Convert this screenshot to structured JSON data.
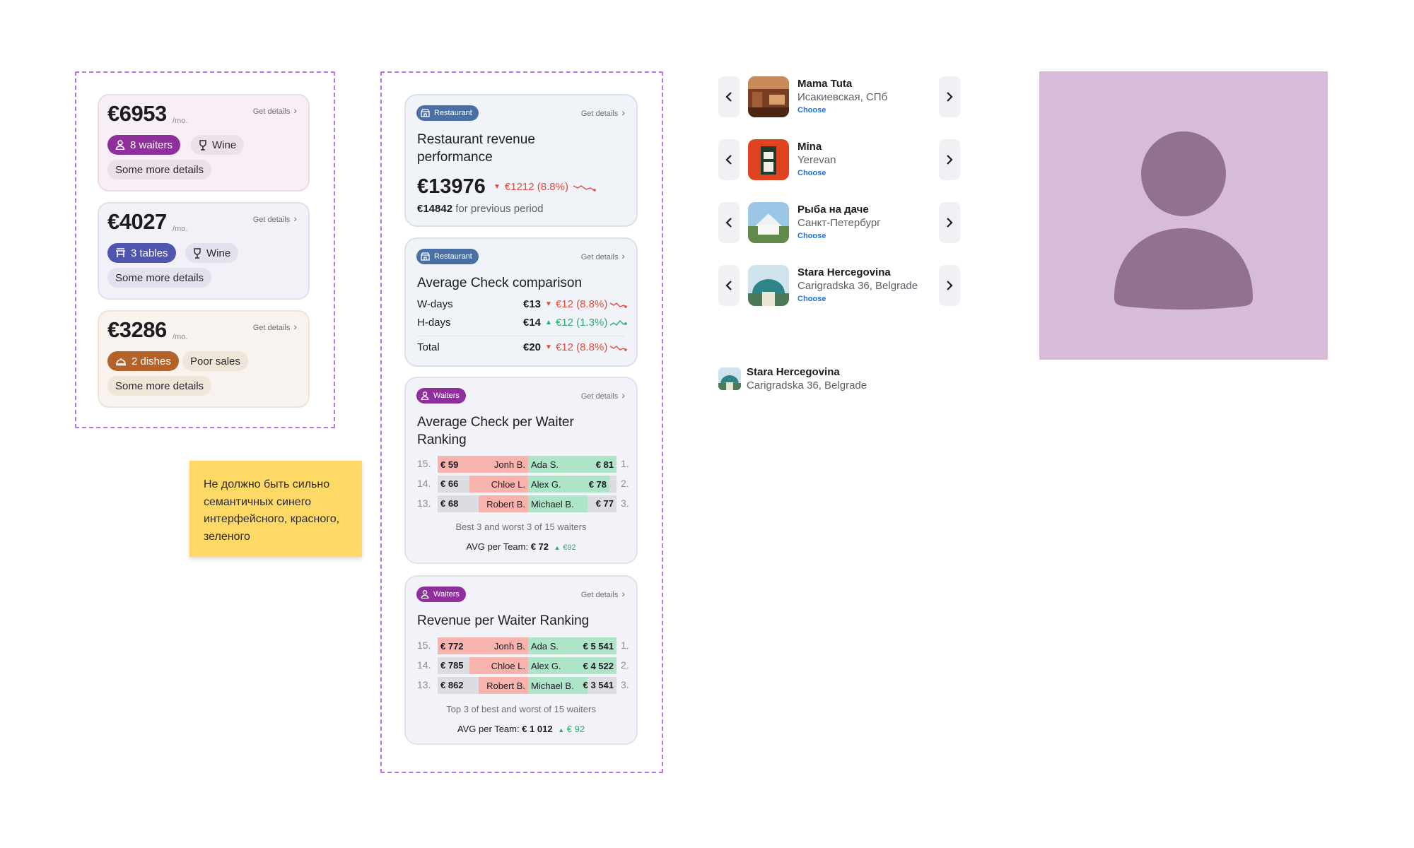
{
  "summary_cards": [
    {
      "amount": "€6953",
      "per": "/mo.",
      "details": "Get details",
      "chip1": "8 waiters",
      "chip2": "Wine",
      "more": "Some more details"
    },
    {
      "amount": "€4027",
      "per": "/mo.",
      "details": "Get details",
      "chip1": "3 tables",
      "chip2": "Wine",
      "more": "Some more details"
    },
    {
      "amount": "€3286",
      "per": "/mo.",
      "details": "Get details",
      "chip1": "2 dishes",
      "chip2": "Poor sales",
      "more": "Some more details"
    }
  ],
  "sticky_note": "Не должно быть сильно семантичных синего интерфейсного, красного, зеленого",
  "revenue_card": {
    "badge": "Restaurant",
    "details": "Get details",
    "title": "Restaurant revenue performance",
    "value": "€13976",
    "delta": "€1212 (8.8%)",
    "previous_value": "€14842",
    "previous_label": "for previous period"
  },
  "avg_check_card": {
    "badge": "Restaurant",
    "details": "Get details",
    "title": "Average Check comparison",
    "rows": [
      {
        "label": "W-days",
        "value": "€13",
        "delta": "€12 (8.8%)"
      },
      {
        "label": "H-days",
        "value": "€14",
        "delta": "€12 (1.3%)"
      },
      {
        "label": "Total",
        "value": "€20",
        "delta": "€12 (8.8%)"
      }
    ]
  },
  "waiter_check_card": {
    "badge": "Waiters",
    "details": "Get details",
    "title": "Average Check per Waiter Ranking",
    "rows": [
      {
        "worst_rank": "15.",
        "worst_value": "€ 59",
        "worst_name": "Jonh B.",
        "best_name": "Ada S.",
        "best_value": "€ 81",
        "best_rank": "1."
      },
      {
        "worst_rank": "14.",
        "worst_value": "€ 66",
        "worst_name": "Chloe L.",
        "best_name": "Alex G.",
        "best_value": "€ 78",
        "best_rank": "2."
      },
      {
        "worst_rank": "13.",
        "worst_value": "€ 68",
        "worst_name": "Robert B.",
        "best_name": "Michael B.",
        "best_value": "€ 77",
        "best_rank": "3."
      }
    ],
    "caption": "Best 3 and worst 3 of 15 waiters",
    "avg_label": "AVG per Team:",
    "avg_value": "€ 72",
    "avg_delta": "€92"
  },
  "waiter_revenue_card": {
    "badge": "Waiters",
    "details": "Get details",
    "title": "Revenue per Waiter Ranking",
    "rows": [
      {
        "worst_rank": "15.",
        "worst_value": "€ 772",
        "worst_name": "Jonh B.",
        "best_name": "Ada S.",
        "best_value": "€ 5 541",
        "best_rank": "1."
      },
      {
        "worst_rank": "14.",
        "worst_value": "€ 785",
        "worst_name": "Chloe L.",
        "best_name": "Alex G.",
        "best_value": "€ 4 522",
        "best_rank": "2."
      },
      {
        "worst_rank": "13.",
        "worst_value": "€ 862",
        "worst_name": "Robert B.",
        "best_name": "Michael B.",
        "best_value": "€ 3 541",
        "best_rank": "3."
      }
    ],
    "caption": "Top 3 of best and worst of 15 waiters",
    "avg_label": "AVG per Team:",
    "avg_value": "€ 1 012",
    "avg_delta": "€ 92"
  },
  "restaurants": [
    {
      "name": "Mama Tuta",
      "address": "Исакиевская, СПб",
      "choose": "Choose"
    },
    {
      "name": "Mina",
      "address": "Yerevan",
      "choose": "Choose"
    },
    {
      "name": "Рыба на даче",
      "address": "Санкт-Петербург",
      "choose": "Choose"
    },
    {
      "name": "Stara Hercegovina",
      "address": "Carigradska 36, Belgrade",
      "choose": "Choose"
    }
  ],
  "selected_restaurant": {
    "name": "Stara Hercegovina",
    "address": "Carigradska 36, Belgrade"
  },
  "colors": {
    "frame_dash": "#b173ee",
    "waiters_badge": "#8e2f9c",
    "restaurant_badge": "#4a6fa5",
    "negative": "#e5483d",
    "positive": "#2eaa6e",
    "avatar_bg": "#d6bcd9",
    "avatar_fg": "#92718f",
    "sticky": "#ffd965"
  }
}
